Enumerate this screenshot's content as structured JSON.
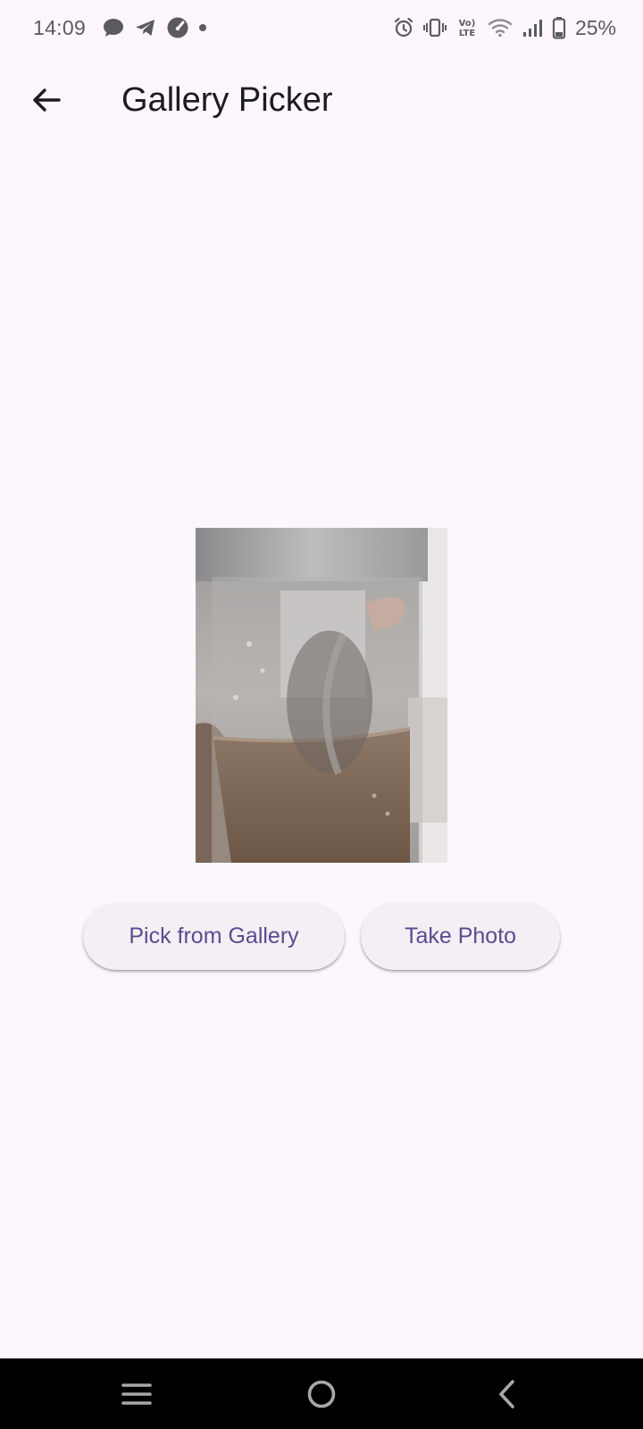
{
  "status_bar": {
    "time": "14:09",
    "battery_percent": "25%",
    "left_icons": [
      "message-icon",
      "telegram-icon",
      "speedometer-icon",
      "dot-icon"
    ],
    "right_icons": [
      "alarm-icon",
      "vibrate-icon",
      "volte-icon",
      "wifi-icon",
      "signal-icon",
      "battery-icon"
    ],
    "volte_label": "Vo) LTE"
  },
  "app_bar": {
    "back_icon": "arrow-back-icon",
    "title": "Gallery Picker"
  },
  "main": {
    "selected_image": "photo of a clear plastic cup containing coffee with milk",
    "buttons": {
      "pick_from_gallery": "Pick from Gallery",
      "take_photo": "Take Photo"
    }
  },
  "nav_bar": {
    "icons": [
      "menu-icon",
      "home-icon",
      "back-chevron-icon"
    ]
  },
  "colors": {
    "background": "#fdf7fd",
    "button_bg": "#f4eff4",
    "button_text": "#5d4a91",
    "title_text": "#1d1b20",
    "status_text": "#5b5b5f",
    "nav_bg": "#000000"
  }
}
